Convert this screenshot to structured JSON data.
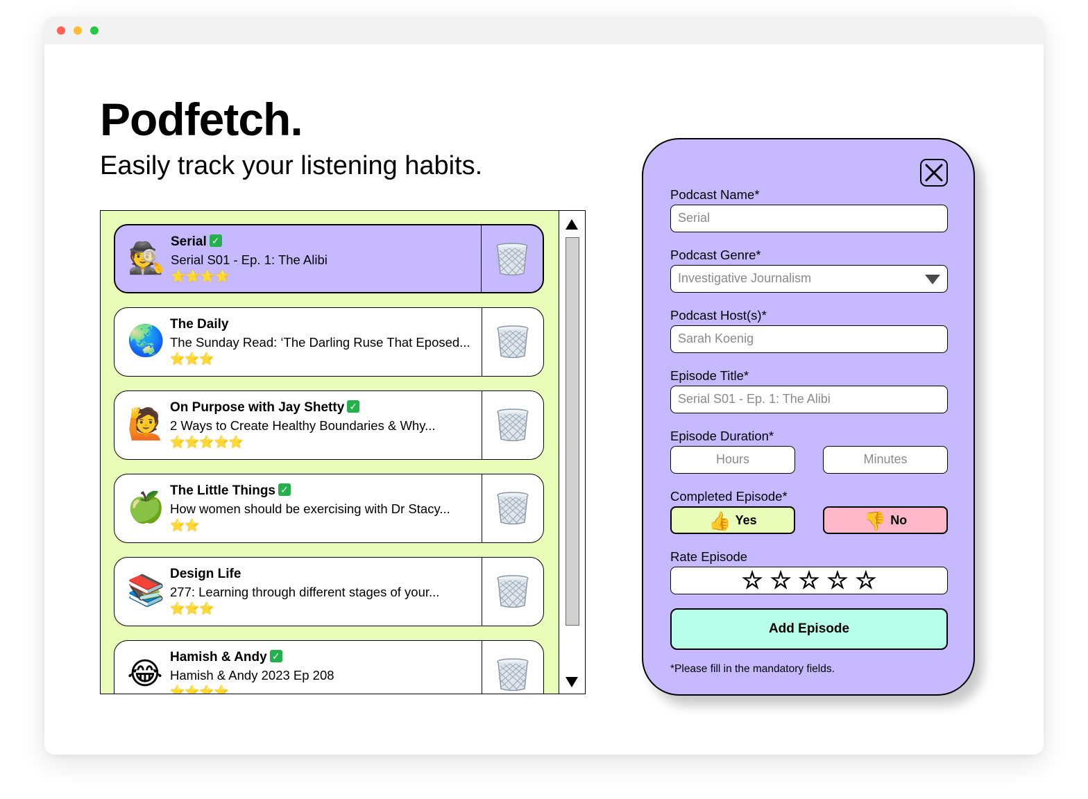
{
  "app": {
    "title": "Podfetch.",
    "subtitle": "Easily track your listening habits."
  },
  "episodes": [
    {
      "emoji": "🕵️",
      "icon": "detective-icon",
      "name": "Serial",
      "verified": true,
      "episode": "Serial S01 - Ep. 1: The Alibi",
      "rating": 4,
      "stars": "⭐⭐⭐⭐",
      "selected": true
    },
    {
      "emoji": "🌏",
      "icon": "globe-icon",
      "name": "The Daily",
      "verified": false,
      "episode": "The Sunday Read: ‘The Darling Ruse That Eposed...",
      "rating": 3,
      "stars": "⭐⭐⭐",
      "selected": false
    },
    {
      "emoji": "🙋",
      "icon": "person-raising-hand-icon",
      "name": "On Purpose with Jay Shetty",
      "verified": true,
      "episode": "2 Ways to Create Healthy Boundaries & Why...",
      "rating": 5,
      "stars": "⭐⭐⭐⭐⭐",
      "selected": false
    },
    {
      "emoji": "🍏",
      "icon": "green-apple-icon",
      "name": "The Little Things",
      "verified": true,
      "episode": "How women should be exercising with Dr Stacy...",
      "rating": 2,
      "stars": "⭐⭐",
      "selected": false
    },
    {
      "emoji": "📚",
      "icon": "books-icon",
      "name": "Design Life",
      "verified": false,
      "episode": "277: Learning through different stages of your...",
      "rating": 3,
      "stars": "⭐⭐⭐",
      "selected": false
    },
    {
      "emoji": "😂",
      "icon": "laughing-face-icon",
      "name": "Hamish & Andy",
      "verified": true,
      "episode": "Hamish & Andy 2023 Ep 208",
      "rating": 4,
      "stars": "⭐⭐⭐⭐",
      "selected": false
    }
  ],
  "check_mark": "✓",
  "form": {
    "podcast_name": {
      "label": "Podcast Name*",
      "value": "Serial"
    },
    "podcast_genre": {
      "label": "Podcast Genre*",
      "value": "Investigative Journalism"
    },
    "podcast_hosts": {
      "label": "Podcast Host(s)*",
      "value": "Sarah Koenig"
    },
    "episode_title": {
      "label": "Episode Title*",
      "value": "Serial S01 - Ep. 1: The Alibi"
    },
    "episode_duration": {
      "label": "Episode Duration*",
      "hours_placeholder": "Hours",
      "minutes_placeholder": "Minutes"
    },
    "completed": {
      "label": "Completed Episode*",
      "yes_label": "Yes",
      "yes_icon": "👍",
      "no_label": "No",
      "no_icon": "👎"
    },
    "rate": {
      "label": "Rate Episode",
      "star": "☆",
      "max": 5,
      "value": 0
    },
    "submit_label": "Add Episode",
    "note": "*Please fill in the mandatory fields."
  },
  "colors": {
    "list_bg": "#eafdb8",
    "selected_card": "#c7b9ff",
    "form_bg": "#c7b9ff",
    "yes_bg": "#eafdb8",
    "no_bg": "#ffb8c9",
    "submit_bg": "#b8ffe9"
  }
}
